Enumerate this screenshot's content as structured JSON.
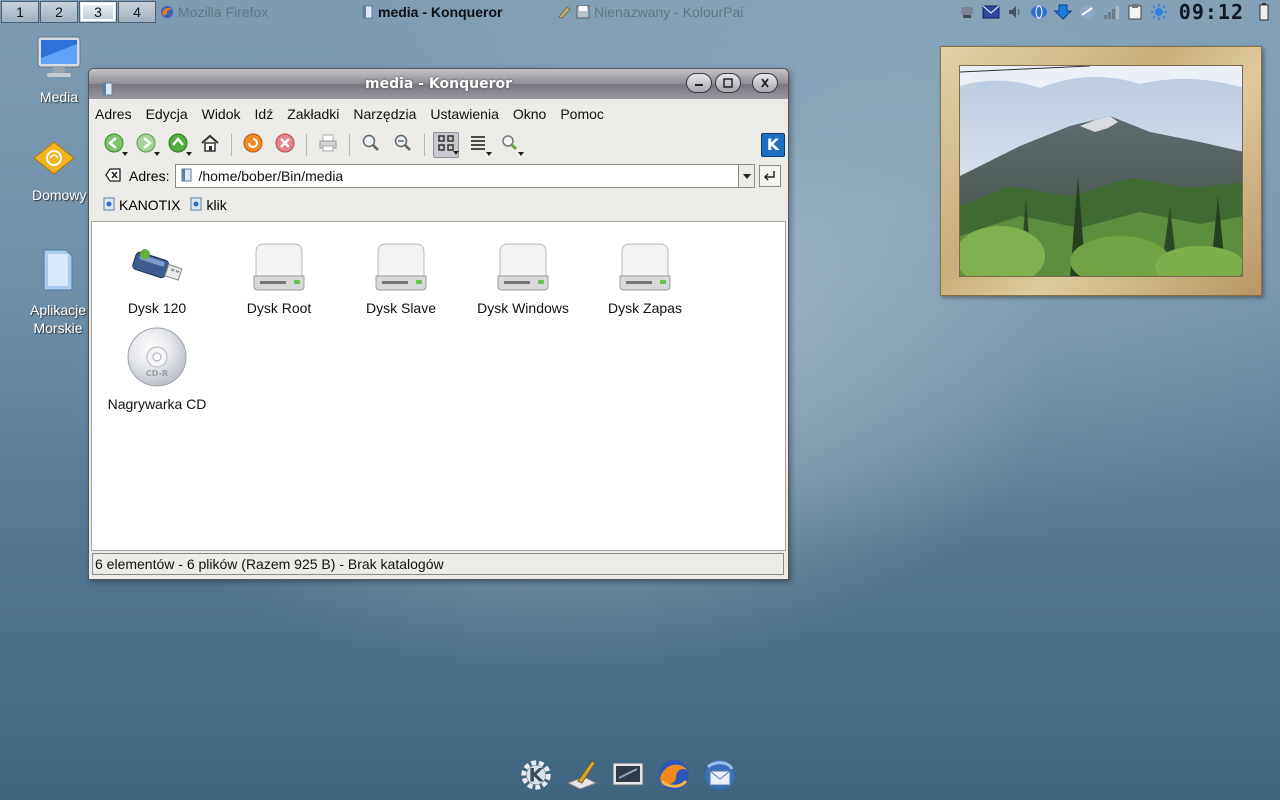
{
  "top_panel": {
    "desktops": [
      "1",
      "2",
      "3",
      "4"
    ],
    "active_desktop": "3",
    "tasks": [
      {
        "label": "Mozilla Firefox",
        "state": "inactive"
      },
      {
        "label": "media - Konqueror",
        "state": "active"
      },
      {
        "label": "Nienazwany - KolourPai",
        "state": "inactive"
      }
    ],
    "clock": "09:12",
    "tray_icons": [
      "network-icon",
      "mail-icon",
      "volume-icon",
      "globe-icon",
      "download-icon",
      "weather-icon",
      "signal-icon",
      "clipboard-icon",
      "sun-icon",
      "battery-icon"
    ]
  },
  "desktop_icons": [
    {
      "label": "Media",
      "icon": "monitor-icon"
    },
    {
      "label": "Domowy",
      "icon": "home-folder-icon"
    },
    {
      "label": "Aplikacje Morskie",
      "icon": "folder-icon"
    }
  ],
  "window": {
    "title": "media - Konqueror",
    "menu": [
      "Adres",
      "Edycja",
      "Widok",
      "Idź",
      "Zakładki",
      "Narzędzia",
      "Ustawienia",
      "Okno",
      "Pomoc"
    ],
    "toolbar": [
      "back-icon",
      "forward-icon",
      "up-icon",
      "home-icon",
      "reload-icon",
      "stop-icon",
      "print-icon",
      "zoom-in-icon",
      "zoom-out-icon",
      "icon-view-icon",
      "list-view-icon",
      "find-icon"
    ],
    "location": {
      "label": "Adres:",
      "value": "/home/bober/Bin/media"
    },
    "bookmarks": [
      "KANOTIX",
      "klik"
    ],
    "files": [
      {
        "name": "Dysk 120",
        "icon": "usb-drive-icon"
      },
      {
        "name": "Dysk Root",
        "icon": "hard-drive-icon"
      },
      {
        "name": "Dysk Slave",
        "icon": "hard-drive-icon"
      },
      {
        "name": "Dysk Windows",
        "icon": "hard-drive-icon"
      },
      {
        "name": "Dysk Zapas",
        "icon": "hard-drive-icon"
      },
      {
        "name": "Nagrywarka CD",
        "icon": "cdr-icon"
      }
    ],
    "status": "6 elementów - 6 plików (Razem 925 B) - Brak katalogów",
    "cdr_label": "CD-R"
  },
  "dock": [
    "kde-menu-icon",
    "kolourpaint-icon",
    "terminal-icon",
    "firefox-icon",
    "thunderbird-icon"
  ],
  "colors": {
    "link_blue": "#1d6fc4",
    "titlebar": "#8e8b93"
  }
}
